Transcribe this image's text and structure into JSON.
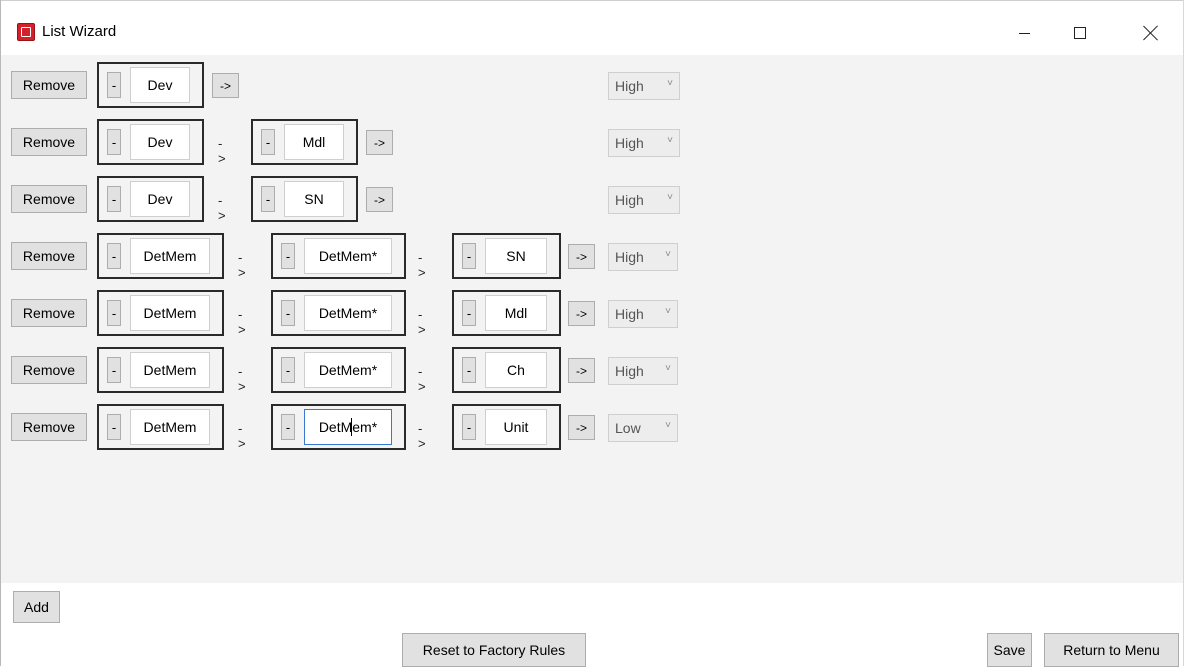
{
  "window": {
    "title": "List Wizard",
    "app_icon": "app-logo-icon",
    "controls": [
      "minimize-icon",
      "maximize-icon",
      "close-icon"
    ]
  },
  "rules": [
    {
      "remove_label": "Remove",
      "minus_label": "-",
      "steps": [
        "Dev"
      ],
      "arrow_label": "->",
      "priority": "High"
    },
    {
      "remove_label": "Remove",
      "minus_label": "-",
      "steps": [
        "Dev",
        "Mdl"
      ],
      "arrow_label": "->",
      "priority": "High"
    },
    {
      "remove_label": "Remove",
      "minus_label": "-",
      "steps": [
        "Dev",
        "SN"
      ],
      "arrow_label": "->",
      "priority": "High"
    },
    {
      "remove_label": "Remove",
      "minus_label": "-",
      "steps": [
        "DetMem",
        "DetMem*",
        "SN"
      ],
      "arrow_label": "->",
      "priority": "High"
    },
    {
      "remove_label": "Remove",
      "minus_label": "-",
      "steps": [
        "DetMem",
        "DetMem*",
        "Mdl"
      ],
      "arrow_label": "->",
      "priority": "High"
    },
    {
      "remove_label": "Remove",
      "minus_label": "-",
      "steps": [
        "DetMem",
        "DetMem*",
        "Ch"
      ],
      "arrow_label": "->",
      "priority": "High"
    },
    {
      "remove_label": "Remove",
      "minus_label": "-",
      "steps": [
        "DetMem",
        "DetMem*",
        "Unit"
      ],
      "arrow_label": "->",
      "priority": "Low"
    }
  ],
  "footer": {
    "add_label": "Add",
    "reset_label": "Reset to Factory Rules",
    "save_label": "Save",
    "return_label": "Return to Menu"
  },
  "colors": {
    "content_background": "#f3f3f3",
    "button_background": "#e1e1e1",
    "focus_border": "#3a78d6",
    "app_icon_red": "#d4202a"
  }
}
